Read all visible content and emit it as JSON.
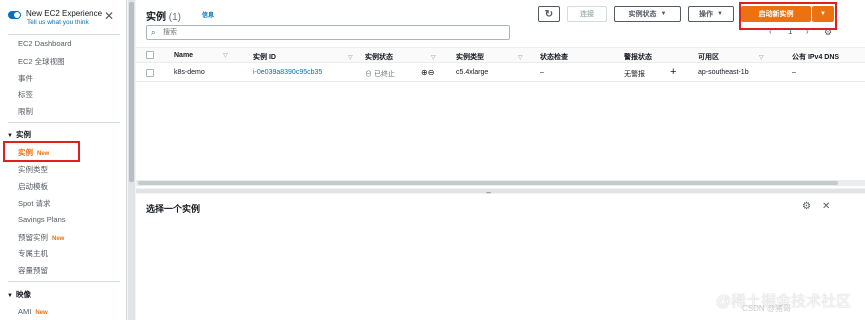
{
  "sidebar": {
    "experience_title": "New EC2 Experience",
    "experience_link": "Tell us what you think",
    "close_glyph": "✕",
    "items_top": [
      {
        "label": "EC2 Dashboard"
      },
      {
        "label": "EC2 全球视图"
      },
      {
        "label": "事件"
      },
      {
        "label": "标签"
      },
      {
        "label": "限制"
      }
    ],
    "section_instances": "实例",
    "instances_items": [
      {
        "label": "实例",
        "badge": "New"
      },
      {
        "label": "实例类型"
      },
      {
        "label": "启动模板"
      },
      {
        "label": "Spot 请求"
      },
      {
        "label": "Savings Plans"
      },
      {
        "label": "预留实例",
        "badge": "New"
      },
      {
        "label": "专属主机"
      },
      {
        "label": "容量预留"
      }
    ],
    "section_images": "映像",
    "images_items": [
      {
        "label": "AMI",
        "badge": "New"
      }
    ]
  },
  "header": {
    "title": "实例",
    "count": "(1)",
    "info": "信息",
    "refresh_glyph": "↻",
    "connect_label": "连接",
    "state_label": "实例状态",
    "actions_label": "操作",
    "launch_label": "启动新实例",
    "dropdown_glyph": "▼"
  },
  "search": {
    "placeholder": "搜索",
    "icon_glyph": "🔍"
  },
  "pager": {
    "prev": "‹",
    "page": "1",
    "next": "›",
    "settings_glyph": "⚙"
  },
  "table": {
    "columns": [
      "Name",
      "实例 ID",
      "实例状态",
      "实例类型",
      "状态检查",
      "警报状态",
      "可用区",
      "公有 IPv4 DNS"
    ],
    "sort_glyph": "▽",
    "rows": [
      {
        "name": "k8s-demo",
        "instance_id": "i-0e039a8390c95cb35",
        "state": "已终止",
        "type": "c5.4xlarge",
        "status_check": "–",
        "alarm": "无警报",
        "zone": "ap-southeast-1b",
        "dns": "–"
      }
    ]
  },
  "bottom": {
    "title": "选择一个实例",
    "drag_glyph": "=",
    "settings_glyph": "⚙",
    "close_glyph": "✕"
  },
  "watermark": {
    "main": "@稀土掘金技术社区",
    "sub": "CSDN @猪哥"
  },
  "colors": {
    "accent": "#ec7211",
    "link": "#0073bb",
    "highlight": "#e02020"
  }
}
